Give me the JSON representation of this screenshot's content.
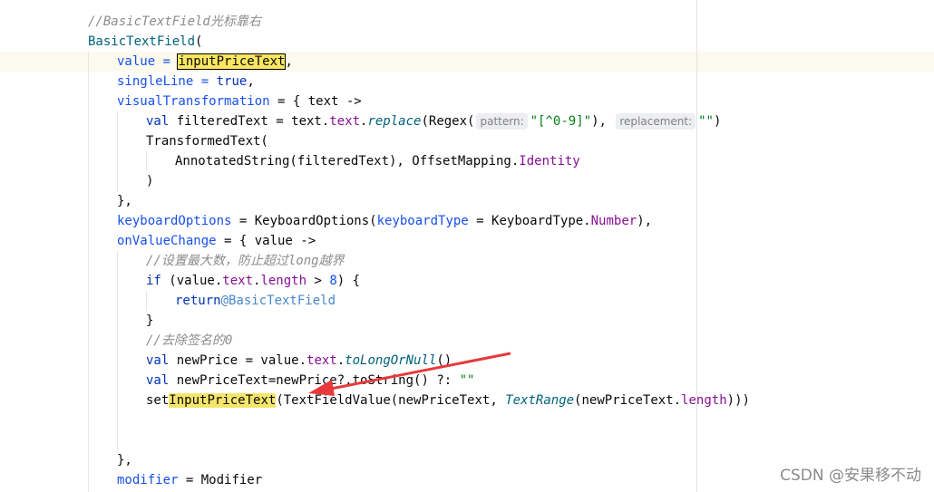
{
  "editor": {
    "lines": {
      "l1_comment": "//BasicTextField光标靠右",
      "l2_call": "BasicTextField",
      "l2_paren": "(",
      "l3_value": "value",
      "l3_eq": " = ",
      "l3_var": "inputPriceText",
      "l3_comma": ",",
      "l4_single": "singleLine",
      "l4_eq": " = ",
      "l4_true": "true",
      "l4_comma": ",",
      "l5_visual": "visualTransformation",
      "l5_rest": " = { text ->",
      "l6_val": "val ",
      "l6_name": "filteredText = text.",
      "l6_text": "text",
      "l6_dot": ".",
      "l6_replace": "replace",
      "l6_regex": "(Regex(",
      "l6_hint1": "pattern:",
      "l6_str1": "\"[^0-9]\"",
      "l6_mid": "),",
      "l6_hint2": "replacement:",
      "l6_str2": "\"\"",
      "l6_end": ")",
      "l7": "TransformedText(",
      "l8_a": "AnnotatedString(filteredText), OffsetMapping.",
      "l8_identity": "Identity",
      "l9": ")",
      "l10": "},",
      "l11_kb": "keyboardOptions",
      "l11_eq": " = KeyboardOptions(",
      "l11_kt": "keyboardType",
      "l11_mid": " = KeyboardType.",
      "l11_number": "Number",
      "l11_end": "),",
      "l12_on": "onValueChange",
      "l12_rest": " = { value ->",
      "l13_comment": "//设置最大数，防止超过long越界",
      "l14_if": "if",
      "l14_a": " (value.",
      "l14_text": "text",
      "l14_dot": ".",
      "l14_length": "length",
      "l14_gt": " > ",
      "l14_num": "8",
      "l14_end": ") {",
      "l15_return": "return",
      "l15_label": "@BasicTextField",
      "l16": "}",
      "l17_comment": "//去除签名的0",
      "l18_val": "val ",
      "l18_a": "newPrice = value.",
      "l18_text": "text",
      "l18_dot": ".",
      "l18_fn": "toLongOrNull",
      "l18_end": "()",
      "l19_val": "val ",
      "l19_a": "newPriceText=newPrice?.",
      "l19_fn": "toString",
      "l19_b": "() ?: ",
      "l19_str": "\"\"",
      "l20_set": "set",
      "l20_hl": "InputPriceText",
      "l20_a": "(TextFieldValue(newPriceText, ",
      "l20_range": "TextRange",
      "l20_b": "(newPriceText.",
      "l20_length": "length",
      "l20_end": ")))",
      "l23": "},",
      "l24_mod": "modifier",
      "l24_rest": " = Modifier"
    }
  },
  "annotation": {
    "arrow_color": "#e8393a"
  },
  "watermark": {
    "text": "CSDN @安果移不动"
  }
}
